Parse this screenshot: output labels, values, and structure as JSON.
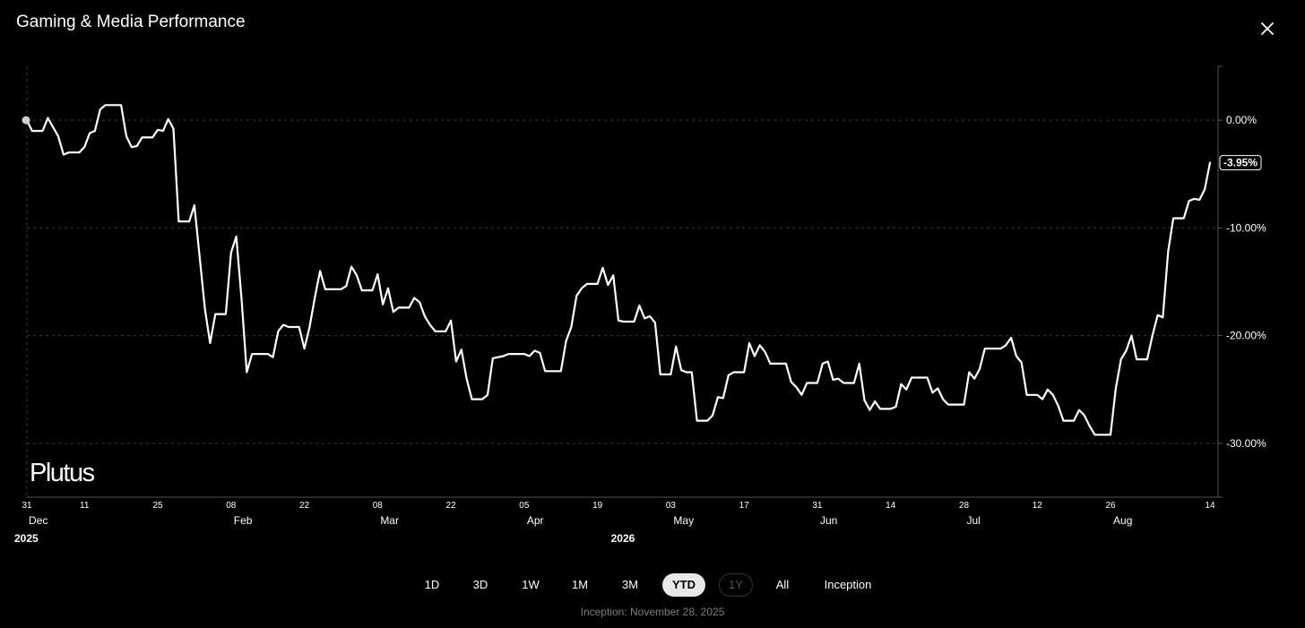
{
  "window": {
    "title": "Gaming & Media Performance",
    "close_icon": "close-icon"
  },
  "brand": {
    "name": "Plutus"
  },
  "chart_data": {
    "type": "line",
    "title": "Gaming & Media Performance",
    "xlabel": "",
    "ylabel": "",
    "x_range": [
      "2025-12-31",
      "2026-08-14"
    ],
    "ylim": [
      -35,
      5
    ],
    "y_ticks": [
      0,
      -10,
      -20,
      -30
    ],
    "y_tick_labels": [
      "0.00%",
      "-10.00%",
      "-20.00%",
      "-30.00%"
    ],
    "y_axis_position": "right",
    "grid": true,
    "current_value": -3.95,
    "current_value_label": "-3.95%",
    "x_ticks": [
      {
        "date": "2025-12-31",
        "day": "31",
        "month": "Dec",
        "year": "2025"
      },
      {
        "date": "2026-01-11",
        "day": "11",
        "month": "",
        "year": ""
      },
      {
        "date": "2026-01-25",
        "day": "25",
        "month": "",
        "year": ""
      },
      {
        "date": "2026-02-08",
        "day": "08",
        "month": "Feb",
        "year": ""
      },
      {
        "date": "2026-02-22",
        "day": "22",
        "month": "",
        "year": ""
      },
      {
        "date": "2026-03-08",
        "day": "08",
        "month": "Mar",
        "year": ""
      },
      {
        "date": "2026-03-22",
        "day": "22",
        "month": "",
        "year": ""
      },
      {
        "date": "2026-04-05",
        "day": "05",
        "month": "Apr",
        "year": ""
      },
      {
        "date": "2026-04-19",
        "day": "19",
        "month": "",
        "year": "2026"
      },
      {
        "date": "2026-05-03",
        "day": "03",
        "month": "May",
        "year": ""
      },
      {
        "date": "2026-05-17",
        "day": "17",
        "month": "",
        "year": ""
      },
      {
        "date": "2026-05-31",
        "day": "31",
        "month": "Jun",
        "year": ""
      },
      {
        "date": "2026-06-14",
        "day": "14",
        "month": "",
        "year": ""
      },
      {
        "date": "2026-06-28",
        "day": "28",
        "month": "Jul",
        "year": ""
      },
      {
        "date": "2026-07-12",
        "day": "12",
        "month": "",
        "year": ""
      },
      {
        "date": "2026-07-26",
        "day": "26",
        "month": "Aug",
        "year": ""
      },
      {
        "date": "2026-08-14",
        "day": "14",
        "month": "",
        "year": ""
      }
    ],
    "series": [
      {
        "color": "#ffffff",
        "points": [
          [
            "2025-12-31",
            0.0
          ],
          [
            "2026-01-01",
            -1.0
          ],
          [
            "2026-01-03",
            -1.0
          ],
          [
            "2026-01-04",
            0.2
          ],
          [
            "2026-01-06",
            -1.5
          ],
          [
            "2026-01-07",
            -3.2
          ],
          [
            "2026-01-08",
            -3.0
          ],
          [
            "2026-01-10",
            -3.0
          ],
          [
            "2026-01-11",
            -2.5
          ],
          [
            "2026-01-12",
            -1.2
          ],
          [
            "2026-01-13",
            -1.0
          ],
          [
            "2026-01-14",
            1.0
          ],
          [
            "2026-01-15",
            1.4
          ],
          [
            "2026-01-17",
            1.4
          ],
          [
            "2026-01-18",
            1.4
          ],
          [
            "2026-01-19",
            -1.5
          ],
          [
            "2026-01-20",
            -2.5
          ],
          [
            "2026-01-21",
            -2.4
          ],
          [
            "2026-01-22",
            -1.6
          ],
          [
            "2026-01-24",
            -1.6
          ],
          [
            "2026-01-25",
            -0.9
          ],
          [
            "2026-01-26",
            -1.0
          ],
          [
            "2026-01-27",
            0.1
          ],
          [
            "2026-01-28",
            -0.8
          ],
          [
            "2026-01-29",
            -9.4
          ],
          [
            "2026-01-31",
            -9.4
          ],
          [
            "2026-02-01",
            -7.9
          ],
          [
            "2026-02-03",
            -17.5
          ],
          [
            "2026-02-04",
            -20.7
          ],
          [
            "2026-02-05",
            -18.0
          ],
          [
            "2026-02-07",
            -18.0
          ],
          [
            "2026-02-08",
            -12.3
          ],
          [
            "2026-02-09",
            -10.8
          ],
          [
            "2026-02-10",
            -16.6
          ],
          [
            "2026-02-11",
            -23.4
          ],
          [
            "2026-02-12",
            -21.7
          ],
          [
            "2026-02-15",
            -21.7
          ],
          [
            "2026-02-16",
            -22.0
          ],
          [
            "2026-02-17",
            -19.6
          ],
          [
            "2026-02-18",
            -19.0
          ],
          [
            "2026-02-19",
            -19.2
          ],
          [
            "2026-02-21",
            -19.2
          ],
          [
            "2026-02-22",
            -21.2
          ],
          [
            "2026-02-23",
            -19.2
          ],
          [
            "2026-02-24",
            -16.5
          ],
          [
            "2026-02-25",
            -14.0
          ],
          [
            "2026-02-26",
            -15.7
          ],
          [
            "2026-02-28",
            -15.7
          ],
          [
            "2026-03-01",
            -15.7
          ],
          [
            "2026-03-02",
            -15.4
          ],
          [
            "2026-03-03",
            -13.6
          ],
          [
            "2026-03-04",
            -14.4
          ],
          [
            "2026-03-05",
            -15.8
          ],
          [
            "2026-03-07",
            -15.8
          ],
          [
            "2026-03-08",
            -14.3
          ],
          [
            "2026-03-09",
            -17.1
          ],
          [
            "2026-03-10",
            -15.6
          ],
          [
            "2026-03-11",
            -17.8
          ],
          [
            "2026-03-12",
            -17.4
          ],
          [
            "2026-03-14",
            -17.4
          ],
          [
            "2026-03-15",
            -16.5
          ],
          [
            "2026-03-16",
            -16.9
          ],
          [
            "2026-03-17",
            -18.2
          ],
          [
            "2026-03-18",
            -19.0
          ],
          [
            "2026-03-19",
            -19.6
          ],
          [
            "2026-03-21",
            -19.6
          ],
          [
            "2026-03-22",
            -18.6
          ],
          [
            "2026-03-23",
            -22.4
          ],
          [
            "2026-03-24",
            -21.3
          ],
          [
            "2026-03-25",
            -24.0
          ],
          [
            "2026-03-26",
            -25.9
          ],
          [
            "2026-03-28",
            -25.9
          ],
          [
            "2026-03-29",
            -25.5
          ],
          [
            "2026-03-30",
            -22.1
          ],
          [
            "2026-04-01",
            -21.9
          ],
          [
            "2026-04-02",
            -21.7
          ],
          [
            "2026-04-05",
            -21.7
          ],
          [
            "2026-04-06",
            -21.9
          ],
          [
            "2026-04-07",
            -21.4
          ],
          [
            "2026-04-08",
            -21.6
          ],
          [
            "2026-04-09",
            -23.3
          ],
          [
            "2026-04-12",
            -23.3
          ],
          [
            "2026-04-13",
            -20.5
          ],
          [
            "2026-04-14",
            -19.2
          ],
          [
            "2026-04-15",
            -16.3
          ],
          [
            "2026-04-16",
            -15.6
          ],
          [
            "2026-04-17",
            -15.2
          ],
          [
            "2026-04-19",
            -15.2
          ],
          [
            "2026-04-20",
            -13.7
          ],
          [
            "2026-04-21",
            -15.3
          ],
          [
            "2026-04-22",
            -14.4
          ],
          [
            "2026-04-23",
            -18.6
          ],
          [
            "2026-04-24",
            -18.7
          ],
          [
            "2026-04-26",
            -18.7
          ],
          [
            "2026-04-27",
            -17.2
          ],
          [
            "2026-04-28",
            -18.4
          ],
          [
            "2026-04-29",
            -18.2
          ],
          [
            "2026-04-30",
            -18.8
          ],
          [
            "2026-05-01",
            -23.6
          ],
          [
            "2026-05-03",
            -23.6
          ],
          [
            "2026-05-04",
            -21.0
          ],
          [
            "2026-05-05",
            -23.2
          ],
          [
            "2026-05-06",
            -23.4
          ],
          [
            "2026-05-07",
            -23.4
          ],
          [
            "2026-05-08",
            -27.9
          ],
          [
            "2026-05-10",
            -27.9
          ],
          [
            "2026-05-11",
            -27.4
          ],
          [
            "2026-05-12",
            -25.7
          ],
          [
            "2026-05-13",
            -25.8
          ],
          [
            "2026-05-14",
            -23.7
          ],
          [
            "2026-05-15",
            -23.4
          ],
          [
            "2026-05-17",
            -23.4
          ],
          [
            "2026-05-18",
            -20.7
          ],
          [
            "2026-05-19",
            -21.9
          ],
          [
            "2026-05-20",
            -20.9
          ],
          [
            "2026-05-21",
            -21.5
          ],
          [
            "2026-05-22",
            -22.6
          ],
          [
            "2026-05-25",
            -22.6
          ],
          [
            "2026-05-26",
            -24.3
          ],
          [
            "2026-05-27",
            -24.8
          ],
          [
            "2026-05-28",
            -25.5
          ],
          [
            "2026-05-29",
            -24.4
          ],
          [
            "2026-05-31",
            -24.4
          ],
          [
            "2026-06-01",
            -22.6
          ],
          [
            "2026-06-02",
            -22.4
          ],
          [
            "2026-06-03",
            -24.1
          ],
          [
            "2026-06-04",
            -24.0
          ],
          [
            "2026-06-05",
            -24.4
          ],
          [
            "2026-06-07",
            -24.4
          ],
          [
            "2026-06-08",
            -22.6
          ],
          [
            "2026-06-09",
            -26.0
          ],
          [
            "2026-06-10",
            -26.9
          ],
          [
            "2026-06-11",
            -26.1
          ],
          [
            "2026-06-12",
            -26.8
          ],
          [
            "2026-06-14",
            -26.8
          ],
          [
            "2026-06-15",
            -26.6
          ],
          [
            "2026-06-16",
            -24.5
          ],
          [
            "2026-06-17",
            -25.0
          ],
          [
            "2026-06-18",
            -23.9
          ],
          [
            "2026-06-21",
            -23.9
          ],
          [
            "2026-06-22",
            -25.3
          ],
          [
            "2026-06-23",
            -24.9
          ],
          [
            "2026-06-24",
            -25.9
          ],
          [
            "2026-06-25",
            -26.4
          ],
          [
            "2026-06-28",
            -26.4
          ],
          [
            "2026-06-29",
            -23.4
          ],
          [
            "2026-06-30",
            -24.0
          ],
          [
            "2026-07-01",
            -23.1
          ],
          [
            "2026-07-02",
            -21.2
          ],
          [
            "2026-07-05",
            -21.2
          ],
          [
            "2026-07-06",
            -20.9
          ],
          [
            "2026-07-07",
            -20.2
          ],
          [
            "2026-07-08",
            -21.9
          ],
          [
            "2026-07-09",
            -22.5
          ],
          [
            "2026-07-10",
            -25.5
          ],
          [
            "2026-07-12",
            -25.5
          ],
          [
            "2026-07-13",
            -25.9
          ],
          [
            "2026-07-14",
            -25.0
          ],
          [
            "2026-07-15",
            -25.5
          ],
          [
            "2026-07-16",
            -26.5
          ],
          [
            "2026-07-17",
            -27.9
          ],
          [
            "2026-07-19",
            -27.9
          ],
          [
            "2026-07-20",
            -26.9
          ],
          [
            "2026-07-21",
            -27.4
          ],
          [
            "2026-07-22",
            -28.4
          ],
          [
            "2026-07-23",
            -29.2
          ],
          [
            "2026-07-26",
            -29.2
          ],
          [
            "2026-07-27",
            -24.9
          ],
          [
            "2026-07-28",
            -22.2
          ],
          [
            "2026-07-29",
            -21.4
          ],
          [
            "2026-07-30",
            -20.0
          ],
          [
            "2026-07-31",
            -22.2
          ],
          [
            "2026-08-02",
            -22.2
          ],
          [
            "2026-08-03",
            -20.0
          ],
          [
            "2026-08-04",
            -18.1
          ],
          [
            "2026-08-05",
            -18.3
          ],
          [
            "2026-08-06",
            -12.2
          ],
          [
            "2026-08-07",
            -9.1
          ],
          [
            "2026-08-09",
            -9.1
          ],
          [
            "2026-08-10",
            -7.5
          ],
          [
            "2026-08-11",
            -7.3
          ],
          [
            "2026-08-12",
            -7.4
          ],
          [
            "2026-08-13",
            -6.4
          ],
          [
            "2026-08-14",
            -3.95
          ]
        ]
      }
    ]
  },
  "timeframes": [
    {
      "label": "1D",
      "state": "normal"
    },
    {
      "label": "3D",
      "state": "normal"
    },
    {
      "label": "1W",
      "state": "normal"
    },
    {
      "label": "1M",
      "state": "normal"
    },
    {
      "label": "3M",
      "state": "normal"
    },
    {
      "label": "YTD",
      "state": "active"
    },
    {
      "label": "1Y",
      "state": "disabled"
    },
    {
      "label": "All",
      "state": "normal"
    },
    {
      "label": "Inception",
      "state": "normal"
    }
  ],
  "footer": {
    "inception_text": "Inception: November 28, 2025"
  },
  "colors": {
    "background": "#000000",
    "line": "#ffffff",
    "grid": "#3a3a3a",
    "axis": "#555555",
    "muted": "#7c7c7c"
  }
}
